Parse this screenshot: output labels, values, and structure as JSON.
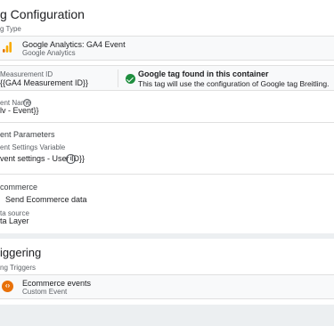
{
  "config": {
    "title": "g Configuration",
    "tag_type_label": "g Type",
    "tag_type_name": "Google Analytics: GA4 Event",
    "tag_type_vendor": "Google Analytics",
    "measurement_id_label": "Measurement ID",
    "measurement_id_value": "{{GA4 Measurement ID}}",
    "tag_found_title": "Google tag found in this container",
    "tag_found_desc": "This tag will use the configuration of Google tag Breitling.",
    "event_name_label": "ent Name",
    "event_name_help": "?",
    "event_name_value": "lv - Event}}",
    "event_params_title": "ent Parameters",
    "event_settings_label": "ent Settings Variable",
    "event_settings_value": "vent settings - User ID}}",
    "event_settings_info": "i",
    "ecommerce_title": "commerce",
    "send_ecommerce_label": "Send Ecommerce data",
    "data_source_label": "ta source",
    "data_source_value": "ta Layer"
  },
  "triggering": {
    "title": "iggering",
    "firing_label": "ng Triggers",
    "trigger_name": "Ecommerce events",
    "trigger_type": "Custom Event"
  },
  "colors": {
    "ga_orange": "#f9ab00",
    "ga_dark_orange": "#e37400",
    "success_green": "#1e8e3e",
    "trigger_orange": "#e8710a"
  },
  "icons": {
    "analytics": "analytics-bars-icon",
    "check": "check-circle-icon",
    "help": "help-icon",
    "info": "info-icon",
    "trigger": "custom-event-icon"
  }
}
